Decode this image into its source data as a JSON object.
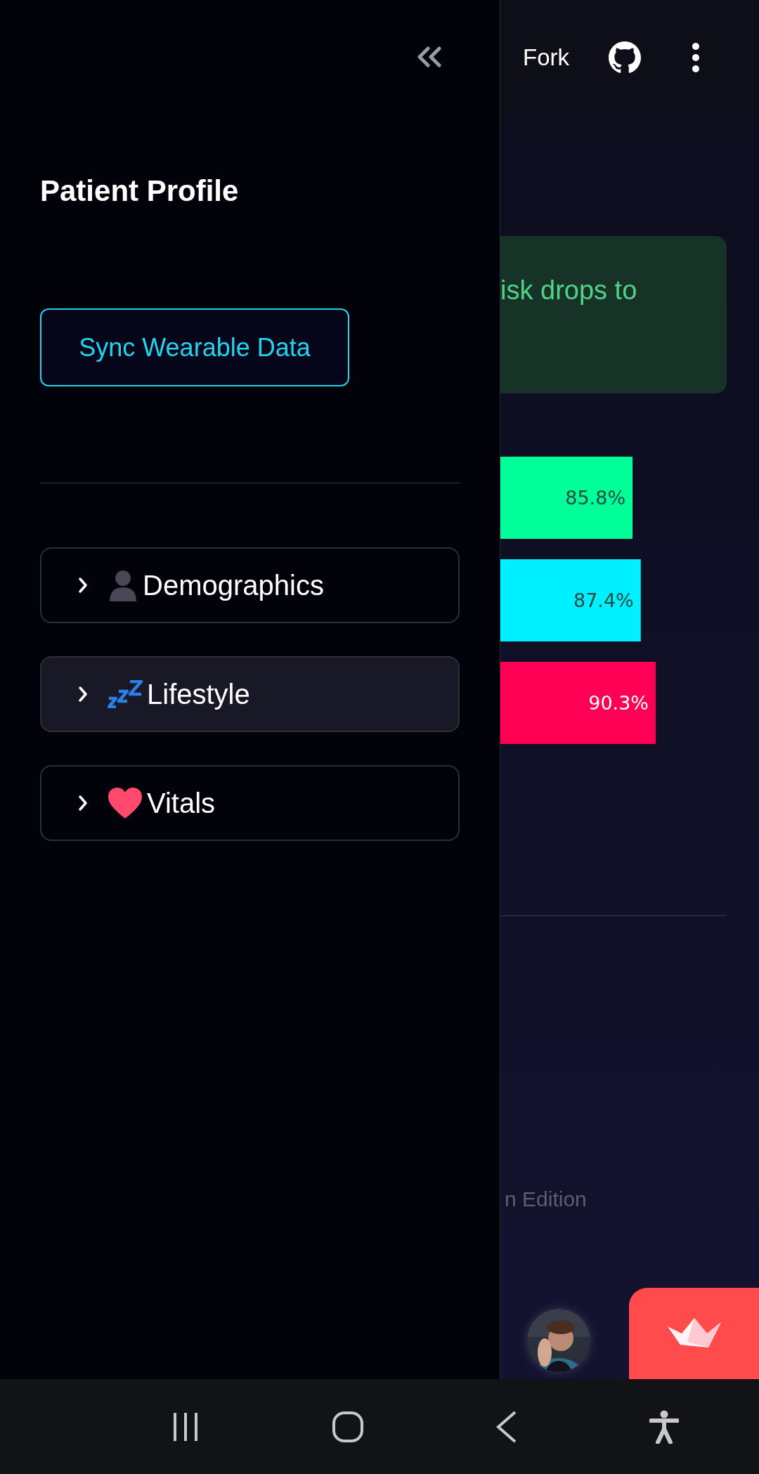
{
  "header": {
    "fork_label": "Fork"
  },
  "sidebar": {
    "title": "Patient Profile",
    "sync_button": "Sync Wearable Data",
    "sections": [
      {
        "label": "Demographics",
        "expanded": false,
        "hovered": false
      },
      {
        "label": "Lifestyle",
        "expanded": false,
        "hovered": true
      },
      {
        "label": "Vitals",
        "expanded": false,
        "hovered": false
      }
    ]
  },
  "main": {
    "alert": {
      "text": "isk drops to"
    },
    "chart_data": {
      "type": "bar",
      "orientation": "horizontal",
      "values": [
        85.8,
        87.4,
        90.3
      ],
      "value_labels": [
        "85.8%",
        "87.4%",
        "90.3%"
      ],
      "colors": [
        "#00ff99",
        "#00f0ff",
        "#ff0055"
      ]
    },
    "footer_text": "n Edition"
  }
}
